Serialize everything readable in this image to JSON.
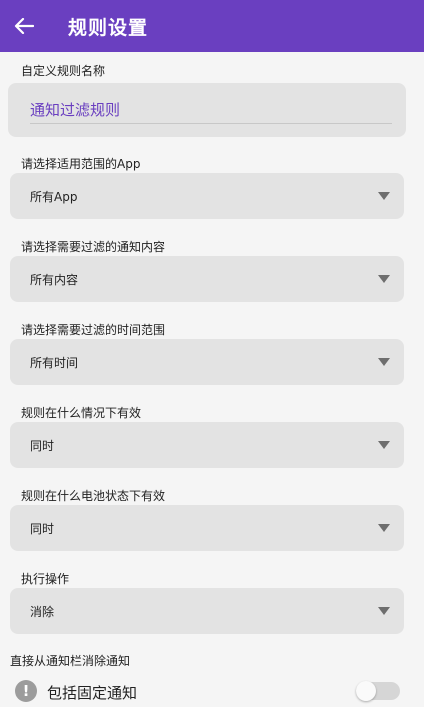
{
  "appbar": {
    "title": "规则设置",
    "back_icon": "arrow-left-icon",
    "color": "#6a3fc0"
  },
  "rule_name": {
    "label": "自定义规则名称",
    "value": "通知过滤规则"
  },
  "app_scope": {
    "label": "请选择适用范围的App",
    "selected": "所有App"
  },
  "content_filter": {
    "label": "请选择需要过滤的通知内容",
    "selected": "所有内容"
  },
  "time_range": {
    "label": "请选择需要过滤的时间范围",
    "selected": "所有时间"
  },
  "condition": {
    "label": "规则在什么情况下有效",
    "selected": "同时"
  },
  "battery_state": {
    "label": "规则在什么电池状态下有效",
    "selected": "同时"
  },
  "action": {
    "label": "执行操作",
    "selected": "消除"
  },
  "dismiss_section": {
    "label": "直接从通知栏消除通知",
    "include_pinned": {
      "label": "包括固定通知",
      "icon": "info-icon",
      "enabled": false
    }
  }
}
